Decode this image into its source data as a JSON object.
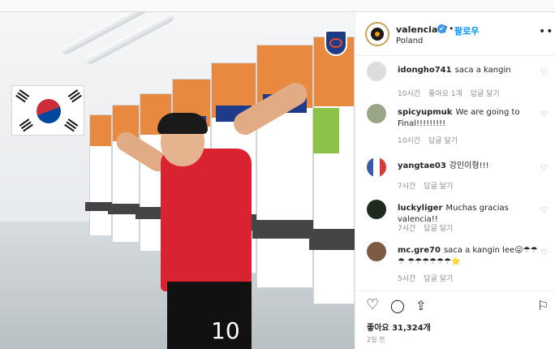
{
  "post": {
    "username": "valenciacf",
    "verified_mark": "✔",
    "follow_label": "팔로우",
    "separator": "•",
    "location": "Poland",
    "more_icon": "•••",
    "photo_jersey_number": "10"
  },
  "comments": [
    {
      "user": "idongho741",
      "text": "saca a kangin",
      "time": "10시간",
      "likes": "좋아요 1개",
      "reply": "답글 달기",
      "avatar_color": "#e6e6e6"
    },
    {
      "user": "spicyupmuk",
      "text": "We are going to Final!!!!!!!!!",
      "time": "10시간",
      "likes": "",
      "reply": "답글 달기",
      "avatar_color": "#9aa58a"
    },
    {
      "user": "yangtae03",
      "text": "강인이형!!!",
      "time": "7시간",
      "likes": "",
      "reply": "답글 달기",
      "avatar_color": "#3b5aa8"
    },
    {
      "user": "luckyliger",
      "text": "Muchas gracias valencia!!",
      "time": "7시간",
      "likes": "",
      "reply": "답글 달기",
      "avatar_color": "#1f2a1f"
    },
    {
      "user": "mc.gre70",
      "text": "saca a kangin lee😛☂☂☂ ☂☂☂☂☂☂⭐",
      "time": "5시간",
      "likes": "",
      "reply": "답글 달기",
      "avatar_color": "#7d5a43"
    }
  ],
  "actions": {
    "like_icon": "♡",
    "comment_icon": "◯",
    "share_icon": "⇪",
    "save_icon": "⚐",
    "likes_text": "좋아요 31,324개",
    "time_ago": "2일 전"
  },
  "colors": {
    "link_blue": "#0095f6",
    "jersey_red": "#d92330",
    "locker_orange": "#e8893f"
  }
}
